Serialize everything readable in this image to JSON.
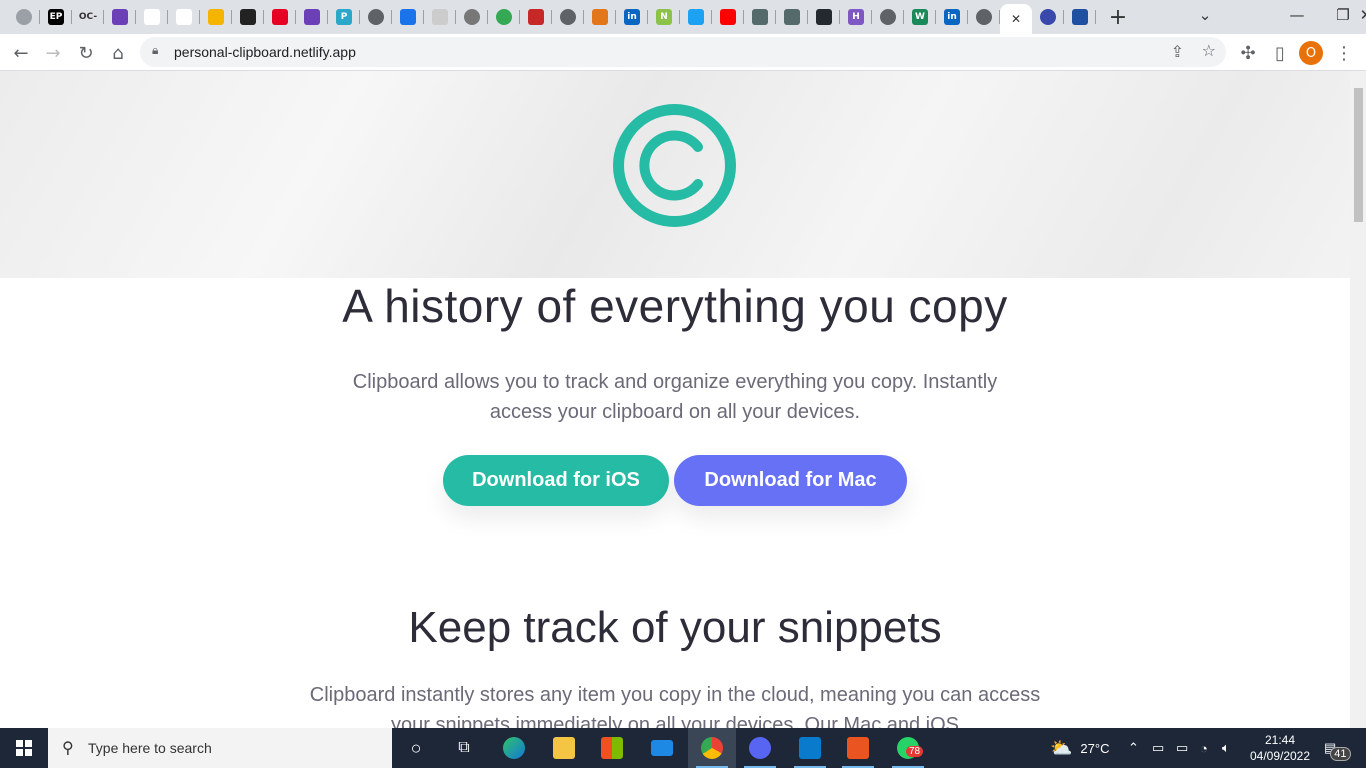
{
  "browser": {
    "tabs": [
      {
        "icon": "target-icon",
        "color": "#9aa0a6",
        "label": ""
      },
      {
        "icon": "ep-icon",
        "color": "#000000",
        "label": "EP"
      },
      {
        "icon": "oc-icon",
        "color": "#dee1e6",
        "label": "OC-"
      },
      {
        "icon": "list-icon",
        "color": "#6b3fb5",
        "label": ""
      },
      {
        "icon": "page-icon",
        "color": "#ffffff",
        "label": ""
      },
      {
        "icon": "page-icon",
        "color": "#ffffff",
        "label": ""
      },
      {
        "icon": "puzzle-icon",
        "color": "#f4b400",
        "label": ""
      },
      {
        "icon": "codepen-icon",
        "color": "#222222",
        "label": ""
      },
      {
        "icon": "pinterest-icon",
        "color": "#e60023",
        "label": ""
      },
      {
        "icon": "list-icon",
        "color": "#6b3fb5",
        "label": ""
      },
      {
        "icon": "p-icon",
        "color": "#2ba7c9",
        "label": "P"
      },
      {
        "icon": "globe-icon",
        "color": "#5f6368",
        "label": ""
      },
      {
        "icon": "messenger-icon",
        "color": "#1a73e8",
        "label": ""
      },
      {
        "icon": "diamond-icon",
        "color": "#cccccc",
        "label": ""
      },
      {
        "icon": "globe-icon",
        "color": "#777777",
        "label": ""
      },
      {
        "icon": "drive-icon",
        "color": "#34a853",
        "label": ""
      },
      {
        "icon": "heart-icon",
        "color": "#c62828",
        "label": ""
      },
      {
        "icon": "globe-icon",
        "color": "#5f6368",
        "label": ""
      },
      {
        "icon": "metamask-icon",
        "color": "#e2761b",
        "label": ""
      },
      {
        "icon": "linkedin-icon",
        "color": "#0a66c2",
        "label": "in"
      },
      {
        "icon": "n-icon",
        "color": "#8bc34a",
        "label": "N"
      },
      {
        "icon": "twitter-icon",
        "color": "#1da1f2",
        "label": ""
      },
      {
        "icon": "youtube-icon",
        "color": "#ff0000",
        "label": ""
      },
      {
        "icon": "photo-icon",
        "color": "#556b6b",
        "label": ""
      },
      {
        "icon": "photo-icon",
        "color": "#556b6b",
        "label": ""
      },
      {
        "icon": "github-icon",
        "color": "#24292f",
        "label": ""
      },
      {
        "icon": "hashnode-icon",
        "color": "#7e57c2",
        "label": "H"
      },
      {
        "icon": "globe-icon",
        "color": "#5f6368",
        "label": ""
      },
      {
        "icon": "w-icon",
        "color": "#1b8a5a",
        "label": "W"
      },
      {
        "icon": "linkedin-icon",
        "color": "#0a66c2",
        "label": "in"
      },
      {
        "icon": "globe-icon",
        "color": "#5f6368",
        "label": ""
      },
      {
        "icon": "close-icon",
        "color": "#ffffff",
        "label": "✕",
        "active": true
      },
      {
        "icon": "brain-icon",
        "color": "#3949ab",
        "label": ""
      },
      {
        "icon": "flag-icon",
        "color": "#1e4fa0",
        "label": ""
      }
    ],
    "new_tab": "+",
    "url": "personal-clipboard.netlify.app",
    "profile_initial": "O"
  },
  "page": {
    "headline": "A history of everything you copy",
    "intro": "Clipboard allows you to track and organize everything you copy. Instantly access your clipboard on all your devices.",
    "btn_ios": "Download for iOS",
    "btn_mac": "Download for Mac",
    "section_title": "Keep track of your snippets",
    "section_text": "Clipboard instantly stores any item you copy in the cloud, meaning you can access your snippets immediately on all your devices. Our Mac and iOS",
    "colors": {
      "teal": "#26bba4",
      "blue": "#6671f5"
    }
  },
  "taskbar": {
    "search_placeholder": "Type here to search",
    "whatsapp_badge": "78",
    "temperature": "27°C",
    "time": "21:44",
    "date": "04/09/2022",
    "notifications": "41"
  }
}
